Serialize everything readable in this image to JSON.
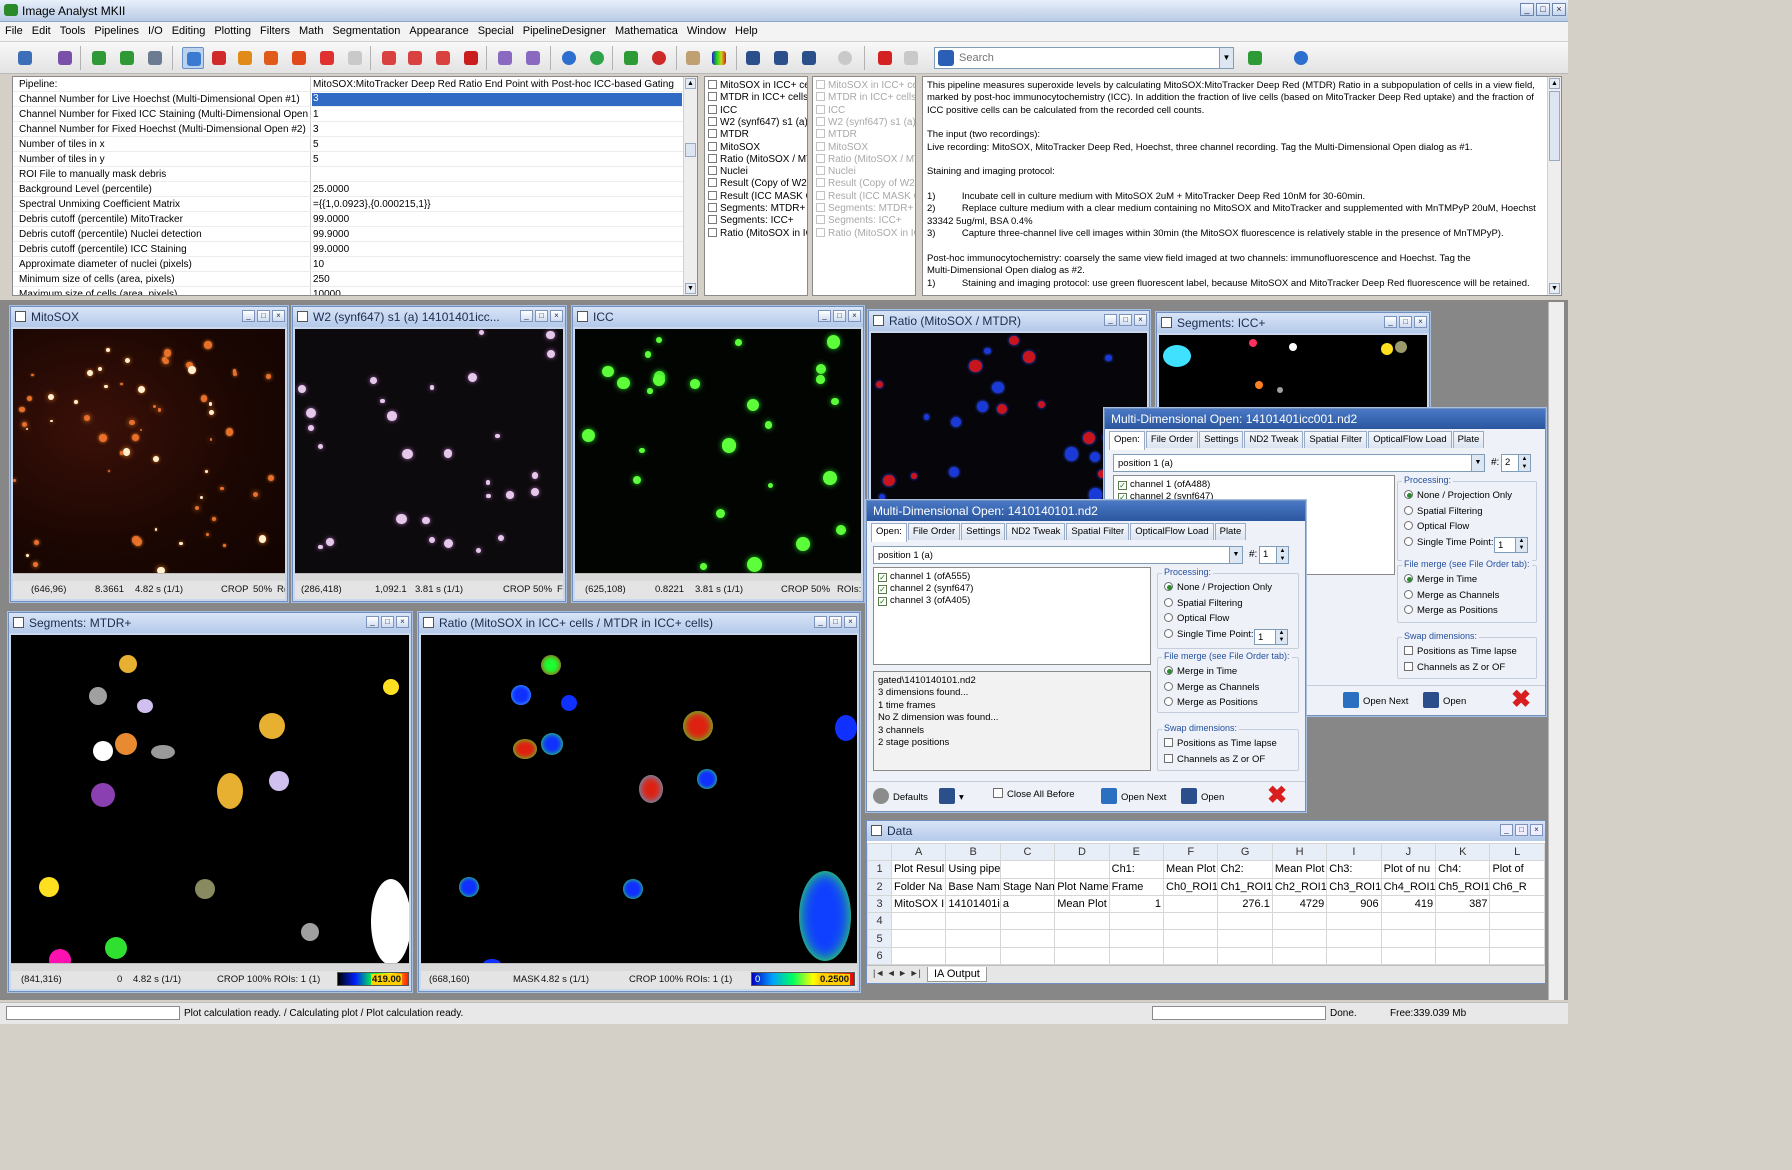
{
  "app": {
    "title": "Image Analyst MKII",
    "accent": "#316ac5"
  },
  "menu": [
    "File",
    "Edit",
    "Tools",
    "Pipelines",
    "I/O",
    "Editing",
    "Plotting",
    "Filters",
    "Math",
    "Segmentation",
    "Appearance",
    "Special",
    "PipelineDesigner",
    "Mathematica",
    "Window",
    "Help"
  ],
  "toolbar": {
    "search_placeholder": "Search"
  },
  "pipeline": {
    "rows": [
      {
        "k": "Pipeline:",
        "v": "MitoSOX:MitoTracker Deep Red Ratio End Point with Post-hoc ICC-based Gating"
      },
      {
        "k": "Channel Number for Live Hoechst (Multi-Dimensional Open #1)",
        "v": "3",
        "selected": true
      },
      {
        "k": "Channel Number for Fixed ICC Staining (Multi-Dimensional Open #2)",
        "v": "1"
      },
      {
        "k": "Channel Number for Fixed Hoechst (Multi-Dimensional Open #2)",
        "v": "3"
      },
      {
        "k": "Number of tiles in x",
        "v": "5"
      },
      {
        "k": "Number of tiles in y",
        "v": "5"
      },
      {
        "k": "ROI File to manually mask debris",
        "v": ""
      },
      {
        "k": "Background Level (percentile)",
        "v": "25.0000"
      },
      {
        "k": "Spectral Unmixing Coefficient Matrix",
        "v": "={{1,0.0923},{0.000215,1}}"
      },
      {
        "k": "Debris cutoff (percentile) MitoTracker",
        "v": "99.0000"
      },
      {
        "k": "Debris cutoff (percentile) Nuclei detection",
        "v": "99.9000"
      },
      {
        "k": "Debris cutoff (percentile) ICC Staining",
        "v": "99.0000"
      },
      {
        "k": "Approximate diameter of nuclei (pixels)",
        "v": "10"
      },
      {
        "k": "Minimum size of cells (area, pixels)",
        "v": "250"
      },
      {
        "k": "Maximum size of cells (area, pixels)",
        "v": "10000"
      }
    ]
  },
  "outputs_a": [
    "MitoSOX  in ICC+ cell",
    "MTDR in ICC+ cells",
    "ICC",
    "W2 (synf647) s1 (a)",
    "MTDR",
    "MitoSOX",
    "Ratio (MitoSOX / MTD",
    "Nuclei",
    "Result (Copy of W2 (",
    "Result (ICC MASK Co",
    "Segments: MTDR+",
    "Segments: ICC+",
    "Ratio (MitoSOX  in IC"
  ],
  "outputs_b": [
    "MitoSOX  in ICC+ cell",
    "MTDR in ICC+ cells",
    "ICC",
    "W2 (synf647) s1 (a)",
    "MTDR",
    "MitoSOX",
    "Ratio (MitoSOX / MTD",
    "Nuclei",
    "Result (Copy of W2 (",
    "Result (ICC MASK Co",
    "Segments: MTDR+",
    "Segments: ICC+",
    "Ratio (MitoSOX  in IC"
  ],
  "description": "This pipeline measures superoxide levels by calculating MitoSOX:MitoTracker Deep Red (MTDR) Ratio in a subpopulation of cells in a view field,\nmarked by post-hoc immunocytochemistry (ICC). In addition the fraction of live cells (based on MitoTracker Deep Red uptake) and the fraction of\nICC positive cells can be calculated from the recorded cell counts.\n\nThe input (two recordings):\nLive recording: MitoSOX, MitoTracker Deep Red, Hoechst, three channel recording. Tag the Multi-Dimensional Open dialog as #1.\n\nStaining and imaging protocol:\n\n1)          Incubate cell in culture medium with MitoSOX 2uM + MitoTracker Deep Red 10nM for 30-60min.\n2)          Replace culture medium with a clear medium containing no MitoSOX and MitoTracker and supplemented with MnTMPyP 20uM, Hoechst\n33342 5ug/ml, BSA 0.4%\n3)          Capture three-channel live cell images within 30min (the MitoSOX fluorescence is relatively stable in the presence of MnTMPyP).\n\nPost-hoc immunocytochemistry: coarsely the same view field imaged at two channels: immunofluorescence and Hoechst. Tag the\nMulti-Dimensional Open dialog as #2.\n1)          Staining and imaging protocol: use green fluorescent label, because MitoSOX and MitoTracker Deep Red fluorescence will be retained.",
  "windows": {
    "mitosox": {
      "title": "MitoSOX",
      "coord": "(646,96)",
      "val": "8.3661",
      "time": "4.82 s (1/1)",
      "crop": "CROP",
      "zoom": "50%",
      "tail": "R("
    },
    "w2": {
      "title": "W2 (synf647) s1 (a) 14101401icc...",
      "coord": "(286,418)",
      "val": "1,092.1",
      "time": "3.81 s (1/1)",
      "crop": "CROP",
      "zoom": "50%",
      "tail": "F"
    },
    "icc": {
      "title": "ICC",
      "coord": "(625,108)",
      "val": "0.8221",
      "time": "3.81 s (1/1)",
      "crop": "CROP",
      "zoom": "50%",
      "tail": "ROIs:"
    },
    "ratio": {
      "title": "Ratio (MitoSOX / MTDR)"
    },
    "segicc": {
      "title": "Segments: ICC+"
    },
    "segmtdr": {
      "title": "Segments: MTDR+",
      "coord": "(841,316)",
      "val": "0",
      "time": "4.82 s (1/1)",
      "crop": "CROP 100% ROIs: 1 (1)",
      "lut": "419.00"
    },
    "ratioicc": {
      "title": "Ratio (MitoSOX  in ICC+ cells / MTDR in ICC+ cells)",
      "coord": "(668,160)",
      "val": "MASK",
      "time": "4.82 s (1/1)",
      "crop": "CROP 100% ROIs: 1 (1)",
      "lut_lo": "0",
      "lut_hi": "0.2500"
    }
  },
  "dlg1": {
    "title": "Multi-Dimensional Open: 14101401icc001.nd2",
    "tabs": [
      "Open:",
      "File Order",
      "Settings",
      "ND2 Tweak",
      "Spatial Filter",
      "OpticalFlow Load",
      "Plate"
    ],
    "position": "position 1 (a)",
    "tag_label": "#:",
    "tag": "2",
    "channels": [
      "channel 1 (ofA488)",
      "channel 2 (synf647)"
    ],
    "processing_label": "Processing:",
    "processing": [
      "None / Projection Only",
      "Spatial Filtering",
      "Optical Flow",
      "Single Time Point:"
    ],
    "single_time": "1",
    "merge_label": "File merge (see File Order tab):",
    "merge": [
      "Merge in Time",
      "Merge as Channels",
      "Merge as Positions"
    ],
    "swap_label": "Swap dimensions:",
    "swap": [
      "Positions as Time lapse",
      "Channels as Z or OF"
    ],
    "footer": {
      "partial": "re",
      "open_next": "Open Next",
      "open": "Open"
    }
  },
  "dlg2": {
    "title": "Multi-Dimensional Open: 1410140101.nd2",
    "tabs": [
      "Open:",
      "File Order",
      "Settings",
      "ND2 Tweak",
      "Spatial Filter",
      "OpticalFlow Load",
      "Plate"
    ],
    "position": "position 1 (a)",
    "tag_label": "#:",
    "tag": "1",
    "channels": [
      "channel 1 (ofA555)",
      "channel 2 (synf647)",
      "channel 3 (ofA405)"
    ],
    "processing_label": "Processing:",
    "processing": [
      "None / Projection Only",
      "Spatial Filtering",
      "Optical Flow",
      "Single Time Point:"
    ],
    "single_time": "1",
    "merge_label": "File merge (see File Order tab):",
    "merge": [
      "Merge in Time",
      "Merge as Channels",
      "Merge as Positions"
    ],
    "swap_label": "Swap dimensions:",
    "swap": [
      "Positions as Time lapse",
      "Channels as Z or OF"
    ],
    "log": [
      "gated\\1410140101.nd2",
      "3 dimensions found...",
      "1 time frames",
      "No Z dimension was found...",
      "3 channels",
      "2 stage positions"
    ],
    "footer": {
      "defaults": "Defaults",
      "close_all": "Close All Before",
      "open_next": "Open Next",
      "open": "Open"
    }
  },
  "data": {
    "title": "Data",
    "cols": [
      "A",
      "B",
      "C",
      "D",
      "E",
      "F",
      "G",
      "H",
      "I",
      "J",
      "K",
      "L"
    ],
    "rows": [
      [
        "Plot Resul",
        "Using pipeline: MitoSOX:MitoT",
        "",
        "",
        "Ch1:",
        "Mean Plot",
        "Ch2:",
        "Mean Plot",
        "Ch3:",
        "Plot of nu",
        "Ch4:",
        "Plot of"
      ],
      [
        "Folder Na",
        "Base Nam",
        "Stage Nan",
        "Plot Name",
        "Frame",
        "Ch0_ROI1",
        "Ch1_ROI1",
        "Ch2_ROI1",
        "Ch3_ROI1",
        "Ch4_ROI1",
        "Ch5_ROI1",
        "Ch6_R"
      ],
      [
        "MitoSOX I",
        "14101401i",
        "a",
        "Mean Plot",
        "1",
        "",
        "276.1",
        "4729",
        "906",
        "419",
        "387",
        ""
      ],
      [
        "",
        "",
        "",
        "",
        "",
        "",
        "",
        "",
        "",
        "",
        "",
        ""
      ],
      [
        "",
        "",
        "",
        "",
        "",
        "",
        "",
        "",
        "",
        "",
        "",
        ""
      ],
      [
        "",
        "",
        "",
        "",
        "",
        "",
        "",
        "",
        "",
        "",
        "",
        ""
      ]
    ],
    "sheet": "IA Output"
  },
  "status": {
    "left": "Plot calculation ready. / Calculating plot / Plot calculation ready.",
    "done": "Done.",
    "mem": "Free:339.039 Mb"
  }
}
